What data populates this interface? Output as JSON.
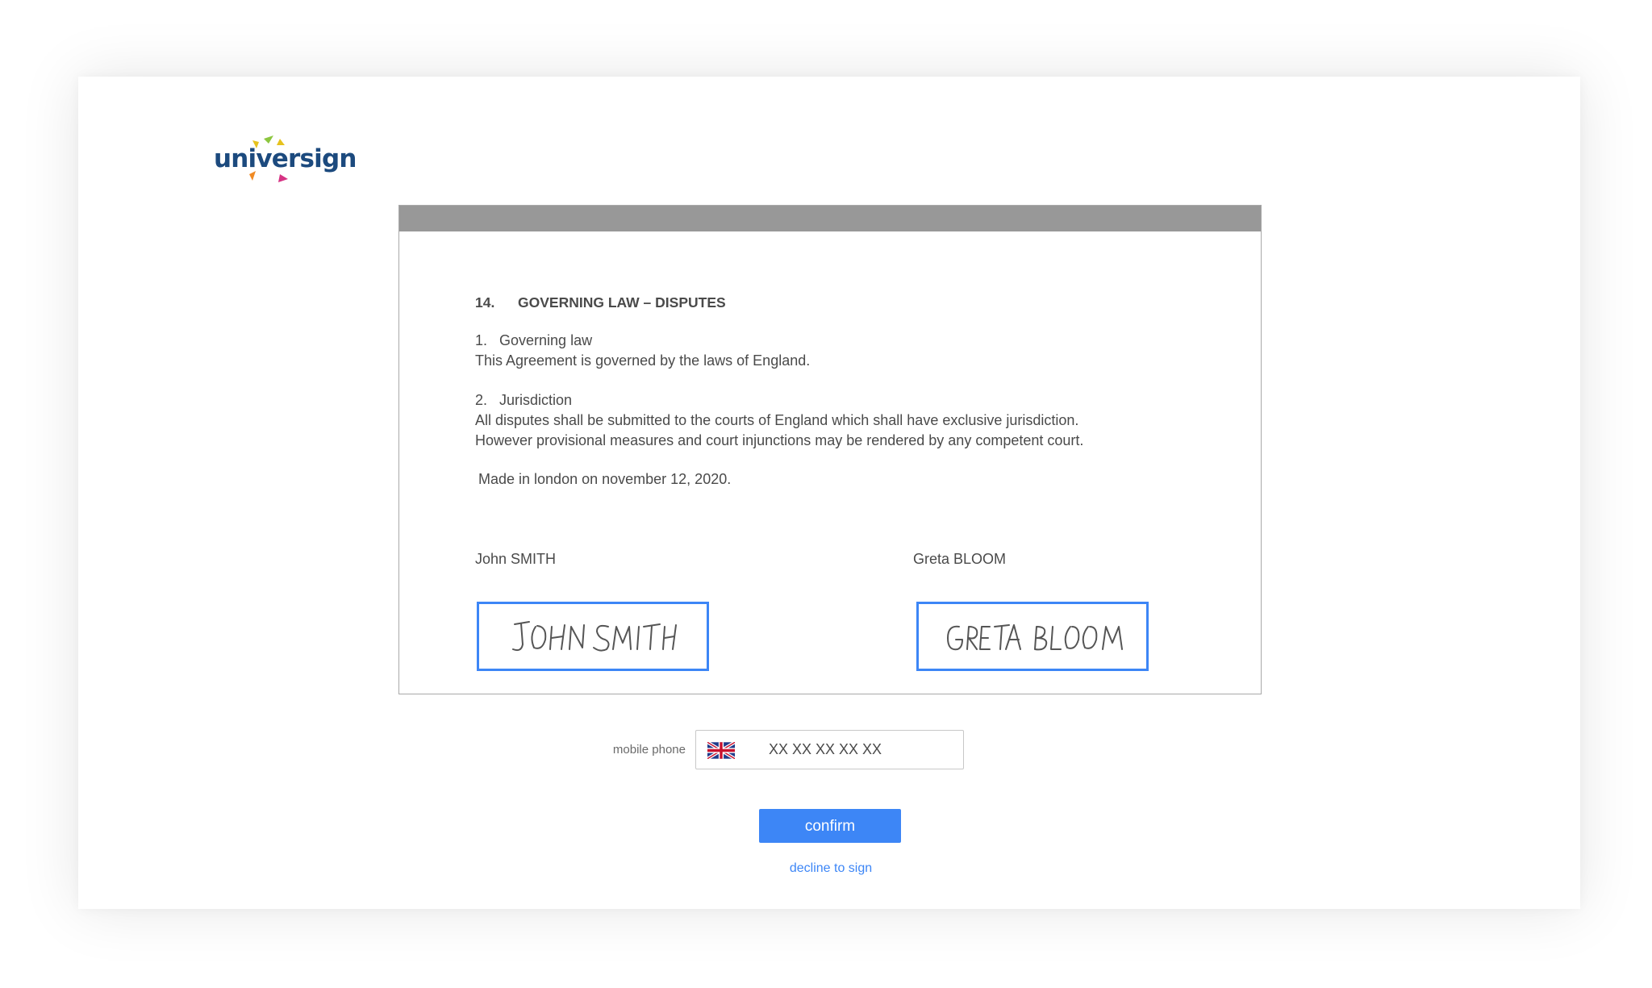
{
  "brand": {
    "logo_text": "universign",
    "colors": {
      "logo_text": "#1c4a7e",
      "ray_yellow": "#e6c21d",
      "ray_green": "#8cc63f",
      "ray_orange": "#f08a24",
      "ray_magenta": "#d63384"
    }
  },
  "document": {
    "heading_number": "14.",
    "heading_title": "GOVERNING LAW – DISPUTES",
    "section1_title": "1.   Governing law",
    "section1_body": "This Agreement is governed by the laws of England.",
    "section2_title": "2.   Jurisdiction",
    "section2_line1": "All disputes shall be submitted to the courts of England which shall have exclusive jurisdiction.",
    "section2_line2": "However provisional measures and court injunctions may be rendered by any competent court.",
    "made_in": "Made in london on november 12, 2020.",
    "signatories": [
      {
        "name": "John SMITH",
        "signature_text": "JOHN SMITH"
      },
      {
        "name": "Greta BLOOM",
        "signature_text": "GRETA BLOOM"
      }
    ]
  },
  "phone": {
    "label": "mobile phone",
    "country_flag": "uk-flag-icon",
    "placeholder": "XX XX XX XX XX",
    "value": ""
  },
  "actions": {
    "confirm_label": "confirm",
    "decline_label": "decline to sign"
  },
  "colors": {
    "accent": "#3d86f6",
    "doc_topbar": "#989898",
    "text": "#4a4a4a"
  }
}
